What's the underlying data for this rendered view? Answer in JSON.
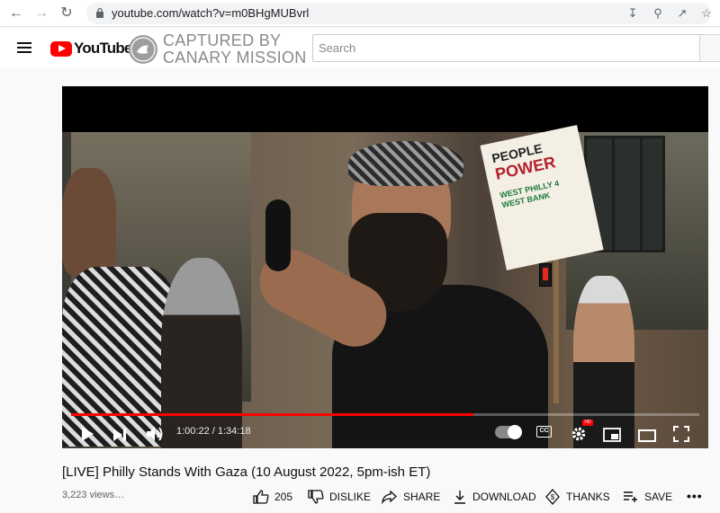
{
  "browser": {
    "url": "youtube.com/watch?v=m0BHgMUBvrl"
  },
  "header": {
    "logo_text": "YouTube",
    "overlay_line1": "CAPTURED BY",
    "overlay_line2": "CANARY MISSION",
    "search_placeholder": "Search"
  },
  "player": {
    "current_time": "1:00:22",
    "duration": "1:34:18",
    "time_display": "1:00:22 / 1:34:18",
    "progress_fraction": 0.64,
    "cc_label": "CC",
    "hd_label": "HD",
    "video_sign_lines": [
      "PEOPLE",
      "POWER",
      "WEST PHILLY 4 WEST BANK"
    ]
  },
  "video": {
    "title": "[LIVE] Philly Stands With Gaza (10 August 2022, 5pm-ish ET)",
    "views": "3,223 views…"
  },
  "actions": {
    "like_count": "205",
    "dislike": "DISLIKE",
    "share": "SHARE",
    "download": "DOWNLOAD",
    "thanks": "THANKS",
    "save": "SAVE",
    "more": "•••"
  },
  "colors": {
    "accent": "#ff0000",
    "text": "#0f0f0f",
    "secondary_text": "#606060"
  }
}
